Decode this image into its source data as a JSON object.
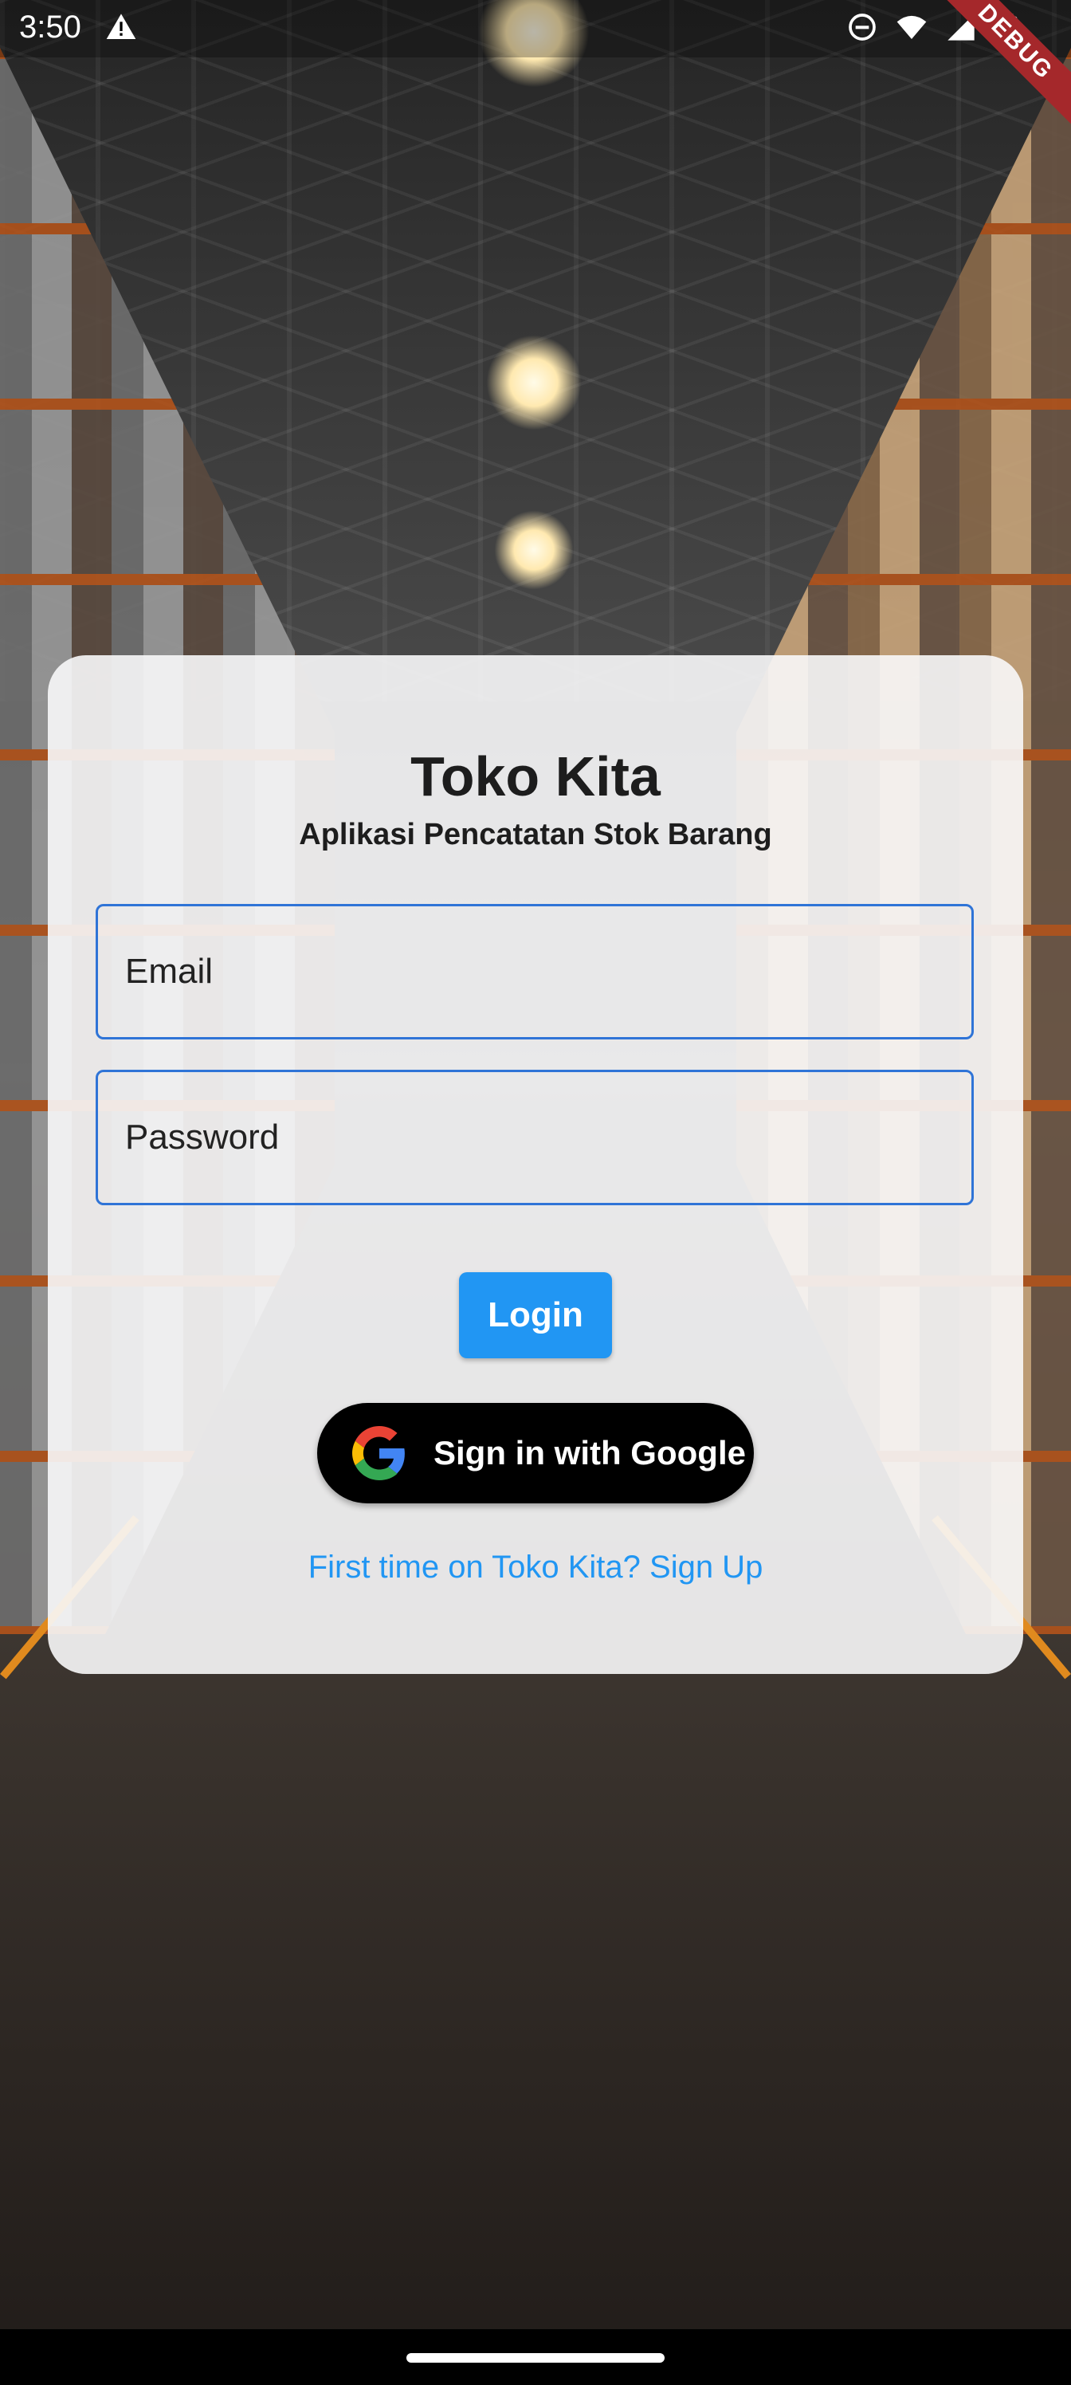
{
  "status_bar": {
    "time": "3:50",
    "debug_banner": "DEBUG"
  },
  "login_card": {
    "title": "Toko Kita",
    "subtitle": "Aplikasi Pencatatan Stok Barang",
    "email_placeholder": "Email",
    "password_placeholder": "Password",
    "login_label": "Login",
    "google_label": "Sign in with Google",
    "signup_link": "First time on Toko Kita? Sign Up"
  },
  "colors": {
    "accent": "#2196f3",
    "field_border": "#2f74d7",
    "google_button": "#000000",
    "debug_ribbon": "#a5282b"
  },
  "icons": [
    "alert-icon",
    "do-not-disturb-icon",
    "wifi-icon",
    "signal-icon",
    "battery-icon",
    "google-icon"
  ]
}
